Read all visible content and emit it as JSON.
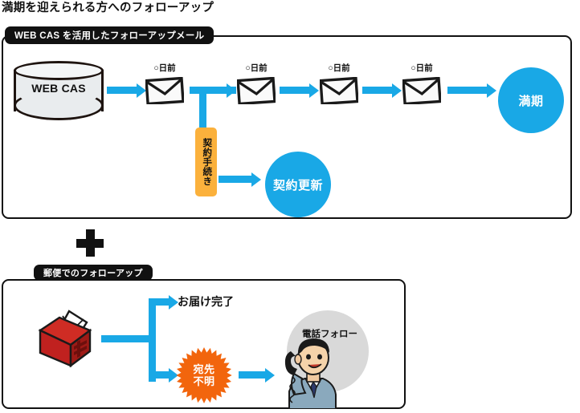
{
  "page": {
    "title": "満期を迎えられる方へのフォローアップ"
  },
  "sections": {
    "mail": {
      "tab_label": "WEB CAS を活用したフォローアップメール",
      "database": {
        "label": "WEB CAS",
        "icon": "cylinder-database-icon"
      },
      "mail_steps": [
        {
          "label": "○日前",
          "icon": "envelope-icon"
        },
        {
          "label": "○日前",
          "icon": "envelope-icon"
        },
        {
          "label": "○日前",
          "icon": "envelope-icon"
        },
        {
          "label": "○日前",
          "icon": "envelope-icon"
        }
      ],
      "branch_box": {
        "label": "契約手続き",
        "color": "#fbb13c"
      },
      "outcomes": [
        {
          "label": "契約更新",
          "color": "#19a8e6"
        },
        {
          "label": "満期",
          "color": "#19a8e6"
        }
      ]
    },
    "post": {
      "tab_label": "郵便でのフォローアップ",
      "mailbox": {
        "icon": "mailbox-icon",
        "color": "#c0211f"
      },
      "branches": [
        {
          "label": "お届け完了",
          "kind": "text"
        },
        {
          "label": "宛先不明",
          "kind": "starburst",
          "color": "#f2650d"
        }
      ],
      "phone_follow": {
        "label": "電話フォロー",
        "icon": "person-on-phone-icon",
        "circle_color": "#d9d9d9"
      }
    }
  },
  "connector": {
    "plus_label": "+",
    "arrow_color": "#19a8e6"
  }
}
